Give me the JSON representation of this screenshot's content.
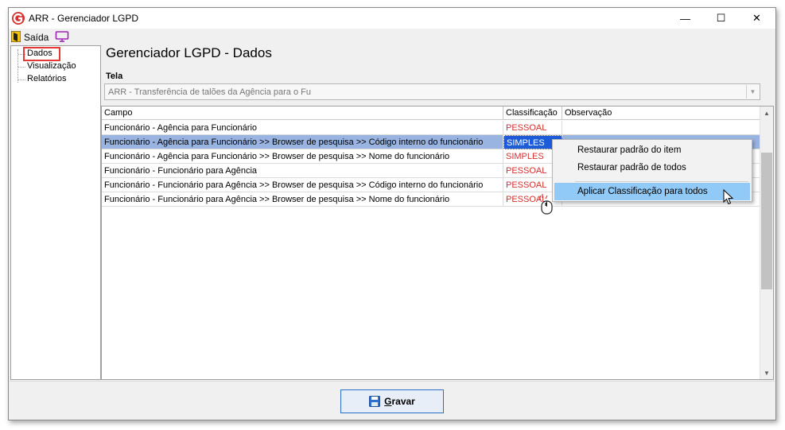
{
  "window": {
    "title": "ARR - Gerenciador LGPD",
    "minimize_glyph": "—",
    "maximize_glyph": "☐",
    "close_glyph": "✕"
  },
  "menubar": {
    "exit_label": "Saída"
  },
  "tree": {
    "items": [
      {
        "label": "Dados",
        "highlighted": true
      },
      {
        "label": "Visualização"
      },
      {
        "label": "Relatórios"
      }
    ]
  },
  "main": {
    "heading": "Gerenciador LGPD - Dados",
    "tela_label": "Tela",
    "tela_value": "ARR - Transferência de talões da Agência para o Fu"
  },
  "grid": {
    "columns": [
      "Campo",
      "Classificação",
      "Observação"
    ],
    "rows": [
      {
        "campo": "Funcionário - Agência para Funcionário",
        "classificacao": "PESSOAL",
        "observacao": ""
      },
      {
        "campo": "Funcionário - Agência para Funcionário >> Browser de pesquisa >> Código interno do funcionário",
        "classificacao": "SIMPLES",
        "observacao": "",
        "selected": true
      },
      {
        "campo": "Funcionário - Agência para Funcionário >> Browser de pesquisa >> Nome do funcionário",
        "classificacao": "SIMPLES",
        "observacao": ""
      },
      {
        "campo": "Funcionário - Funcionário para Agência",
        "classificacao": "PESSOAL",
        "observacao": ""
      },
      {
        "campo": "Funcionário - Funcionário para Agência >> Browser de pesquisa >> Código interno do funcionário",
        "classificacao": "PESSOAL",
        "observacao": ""
      },
      {
        "campo": "Funcionário - Funcionário para Agência >> Browser de pesquisa >> Nome do funcionário",
        "classificacao": "PESSOAL",
        "observacao": ""
      }
    ]
  },
  "context_menu": {
    "items": [
      "Restaurar padrão do item",
      "Restaurar padrão de todos",
      "Aplicar Classificação para todos"
    ],
    "hover_index": 2
  },
  "footer": {
    "save_label_prefix": "",
    "save_label_underlined": "G",
    "save_label_rest": "ravar"
  },
  "colors": {
    "accent": "#1e5bd8",
    "selection_row": "#99b4e0",
    "red_text": "#d32f2f",
    "highlight_box": "#e53935",
    "menu_hover": "#91c9f7",
    "exit_icon_bg": "#f4c20d",
    "monitor_icon": "#9c27b0"
  },
  "icons": {
    "app": "app-logo-icon",
    "exit": "exit-door-icon",
    "monitor": "monitor-icon",
    "save": "floppy-disk-icon"
  }
}
